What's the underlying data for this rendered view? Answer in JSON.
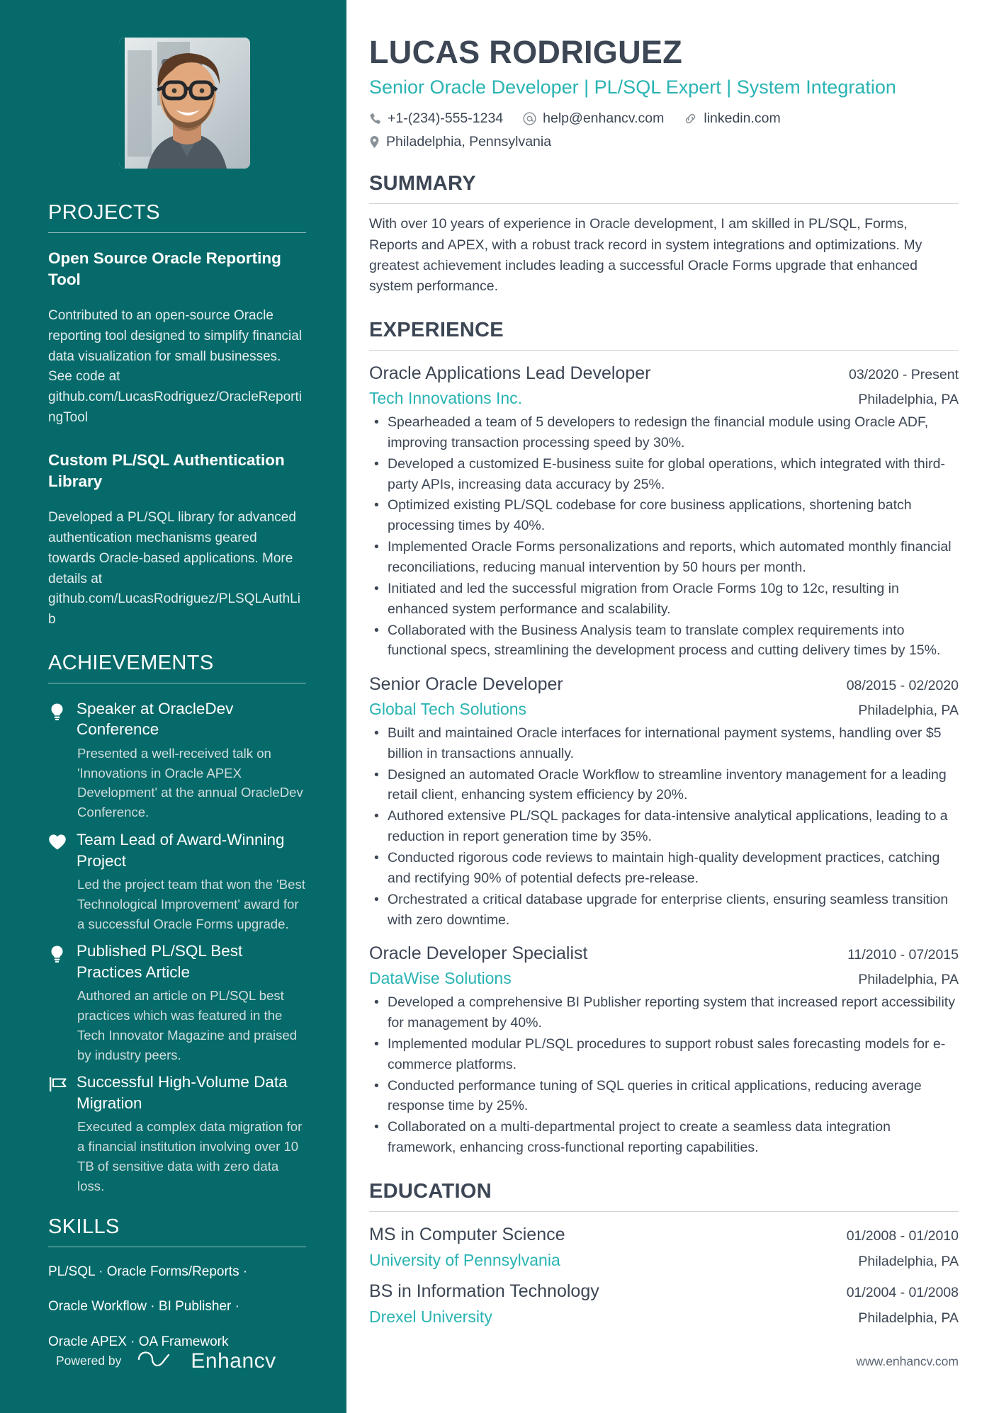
{
  "header": {
    "name": "LUCAS RODRIGUEZ",
    "headline": "Senior Oracle Developer | PL/SQL Expert | System Integration",
    "contacts": {
      "phone": "+1-(234)-555-1234",
      "email": "help@enhancv.com",
      "link": "linkedin.com",
      "location": "Philadelphia, Pennsylvania"
    }
  },
  "sidebar": {
    "projects": {
      "title": "PROJECTS",
      "items": [
        {
          "name": "Open Source Oracle Reporting Tool",
          "description": "Contributed to an open-source Oracle reporting tool designed to simplify financial data visualization for small businesses. See code at github.com/LucasRodriguez/OracleReportingTool"
        },
        {
          "name": "Custom PL/SQL Authentication Library",
          "description": "Developed a PL/SQL library for advanced authentication mechanisms geared towards Oracle-based applications. More details at github.com/LucasRodriguez/PLSQLAuthLib"
        }
      ]
    },
    "achievements": {
      "title": "ACHIEVEMENTS",
      "items": [
        {
          "icon": "lightbulb-icon",
          "name": "Speaker at OracleDev Conference",
          "description": "Presented a well-received talk on 'Innovations in Oracle APEX Development' at the annual OracleDev Conference."
        },
        {
          "icon": "heart-icon",
          "name": "Team Lead of Award-Winning Project",
          "description": "Led the project team that won the 'Best Technological Improvement' award for a successful Oracle Forms upgrade."
        },
        {
          "icon": "lightbulb-icon",
          "name": "Published PL/SQL Best Practices Article",
          "description": "Authored an article on PL/SQL best practices which was featured in the Tech Innovator Magazine and praised by industry peers."
        },
        {
          "icon": "flag-icon",
          "name": "Successful High-Volume Data Migration",
          "description": "Executed a complex data migration for a financial institution involving over 10 TB of sensitive data with zero data loss."
        }
      ]
    },
    "skills": {
      "title": "SKILLS",
      "lines": [
        "PL/SQL · Oracle Forms/Reports ·",
        "Oracle Workflow · BI Publisher ·",
        "Oracle APEX · OA Framework"
      ]
    },
    "footer": {
      "powered_by": "Powered by",
      "brand": "Enhancv"
    }
  },
  "main": {
    "summary": {
      "title": "SUMMARY",
      "text": "With over 10 years of experience in Oracle development, I am skilled in PL/SQL, Forms, Reports and APEX, with a robust track record in system integrations and optimizations. My greatest achievement includes leading a successful Oracle Forms upgrade that enhanced system performance."
    },
    "experience": {
      "title": "EXPERIENCE",
      "jobs": [
        {
          "title": "Oracle Applications Lead Developer",
          "date": "03/2020 - Present",
          "company": "Tech Innovations Inc.",
          "location": "Philadelphia, PA",
          "bullets": [
            "Spearheaded a team of 5 developers to redesign the financial module using Oracle ADF, improving transaction processing speed by 30%.",
            "Developed a customized E-business suite for global operations, which integrated with third-party APIs, increasing data accuracy by 25%.",
            "Optimized existing PL/SQL codebase for core business applications, shortening batch processing times by 40%.",
            "Implemented Oracle Forms personalizations and reports, which automated monthly financial reconciliations, reducing manual intervention by 50 hours per month.",
            "Initiated and led the successful migration from Oracle Forms 10g to 12c, resulting in enhanced system performance and scalability.",
            "Collaborated with the Business Analysis team to translate complex requirements into functional specs, streamlining the development process and cutting delivery times by 15%."
          ]
        },
        {
          "title": "Senior Oracle Developer",
          "date": "08/2015 - 02/2020",
          "company": "Global Tech Solutions",
          "location": "Philadelphia, PA",
          "bullets": [
            "Built and maintained Oracle interfaces for international payment systems, handling over $5 billion in transactions annually.",
            "Designed an automated Oracle Workflow to streamline inventory management for a leading retail client, enhancing system efficiency by 20%.",
            "Authored extensive PL/SQL packages for data-intensive analytical applications, leading to a reduction in report generation time by 35%.",
            "Conducted rigorous code reviews to maintain high-quality development practices, catching and rectifying 90% of potential defects pre-release.",
            "Orchestrated a critical database upgrade for enterprise clients, ensuring seamless transition with zero downtime."
          ]
        },
        {
          "title": "Oracle Developer Specialist",
          "date": "11/2010 - 07/2015",
          "company": "DataWise Solutions",
          "location": "Philadelphia, PA",
          "bullets": [
            "Developed a comprehensive BI Publisher reporting system that increased report accessibility for management by 40%.",
            "Implemented modular PL/SQL procedures to support robust sales forecasting models for e-commerce platforms.",
            "Conducted performance tuning of SQL queries in critical applications, reducing average response time by 25%.",
            "Collaborated on a multi-departmental project to create a seamless data integration framework, enhancing cross-functional reporting capabilities."
          ]
        }
      ]
    },
    "education": {
      "title": "EDUCATION",
      "items": [
        {
          "degree": "MS in Computer Science",
          "date": "01/2008 - 01/2010",
          "school": "University of Pennsylvania",
          "location": "Philadelphia, PA"
        },
        {
          "degree": "BS in Information Technology",
          "date": "01/2004 - 01/2008",
          "school": "Drexel University",
          "location": "Philadelphia, PA"
        }
      ]
    },
    "footer": {
      "website": "www.enhancv.com"
    }
  },
  "colors": {
    "sidebar": "#076A6A",
    "accent": "#2ab3b3",
    "text": "#3c4654"
  }
}
